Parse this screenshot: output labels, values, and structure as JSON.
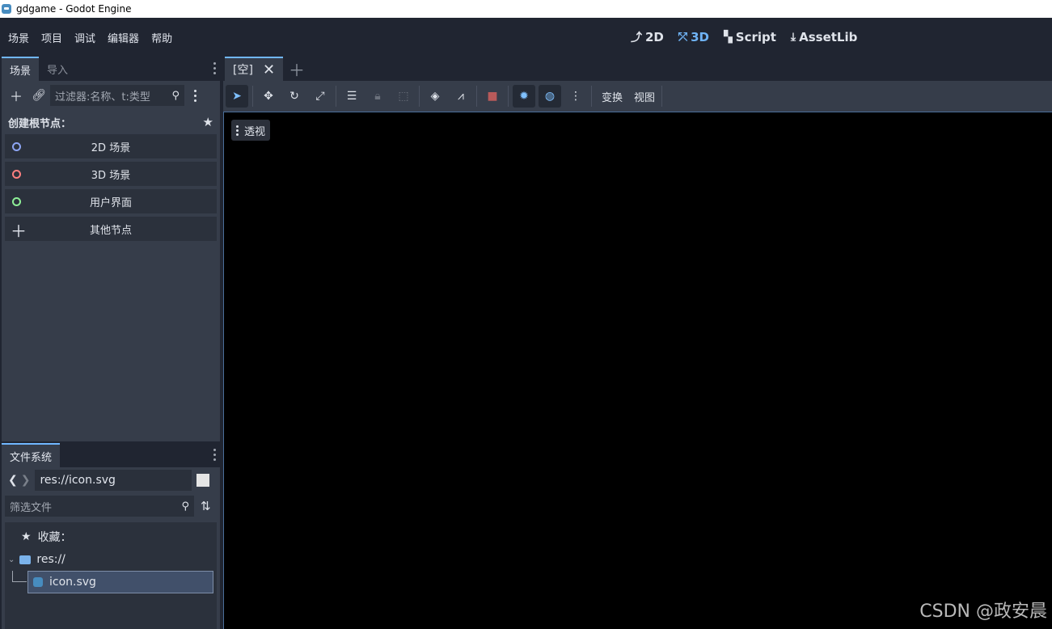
{
  "window": {
    "title": "gdgame - Godot Engine"
  },
  "menu": {
    "items": [
      "场景",
      "项目",
      "调试",
      "编辑器",
      "帮助"
    ]
  },
  "workspaces": [
    {
      "label": "2D",
      "icon": "2d-icon"
    },
    {
      "label": "3D",
      "icon": "3d-icon"
    },
    {
      "label": "Script",
      "icon": "script-icon"
    },
    {
      "label": "AssetLib",
      "icon": "download-icon"
    }
  ],
  "scene_dock": {
    "tabs": [
      "场景",
      "导入"
    ],
    "filter_placeholder": "过滤器:名称、t:类型",
    "create_root_label": "创建根节点：",
    "root_buttons": [
      {
        "label": "2D 场景",
        "color": "#8da5f3"
      },
      {
        "label": "3D 场景",
        "color": "#fc7f7f"
      },
      {
        "label": "用户界面",
        "color": "#8eef97"
      },
      {
        "label": "其他节点"
      }
    ]
  },
  "filesystem": {
    "tab": "文件系统",
    "path": "res://icon.svg",
    "filter_placeholder": "筛选文件",
    "favorites_label": "收藏：",
    "root_label": "res://",
    "file_label": "icon.svg"
  },
  "editor": {
    "doc_tab": "[空]",
    "toolbar_text": [
      "变换",
      "视图"
    ],
    "viewport_label": "透视"
  },
  "watermark": "CSDN @政安晨"
}
